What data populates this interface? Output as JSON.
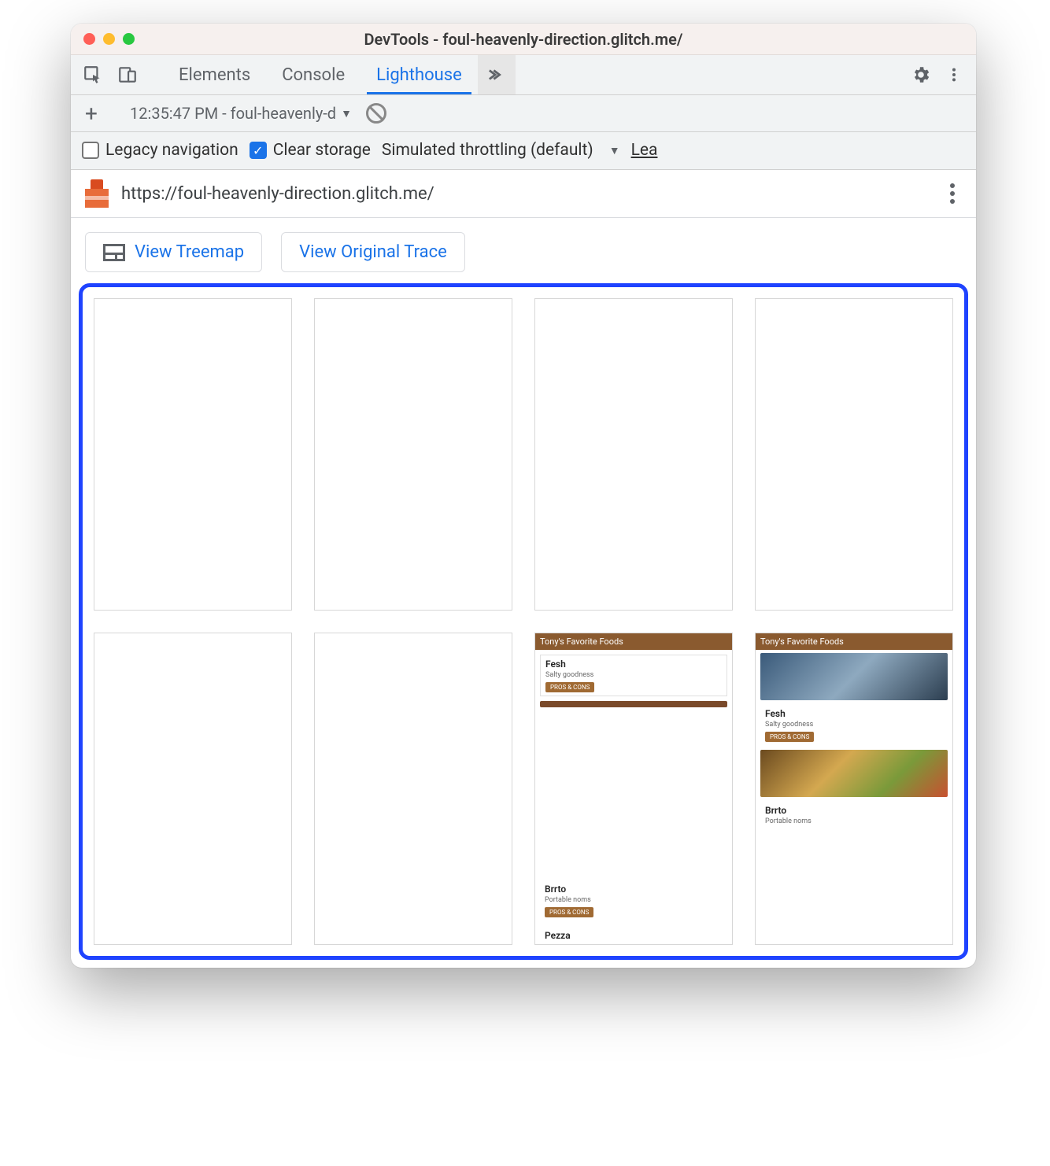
{
  "window": {
    "title": "DevTools - foul-heavenly-direction.glitch.me/"
  },
  "tabs": {
    "elements": "Elements",
    "console": "Console",
    "lighthouse": "Lighthouse"
  },
  "reportbar": {
    "selected": "12:35:47 PM - foul-heavenly-d"
  },
  "options": {
    "legacy_label": "Legacy navigation",
    "clear_label": "Clear storage",
    "throttling_label": "Simulated throttling (default)",
    "learn_trunc": "Lea"
  },
  "url": "https://foul-heavenly-direction.glitch.me/",
  "actions": {
    "treemap": "View Treemap",
    "trace": "View Original Trace"
  },
  "filmstrip": {
    "header": "Tony's Favorite Foods",
    "pill": "PROS & CONS",
    "items": [
      {
        "name": "Fesh",
        "sub": "Salty goodness"
      },
      {
        "name": "Brrto",
        "sub": "Portable noms"
      },
      {
        "name": "Pezza",
        "sub": ""
      }
    ]
  }
}
